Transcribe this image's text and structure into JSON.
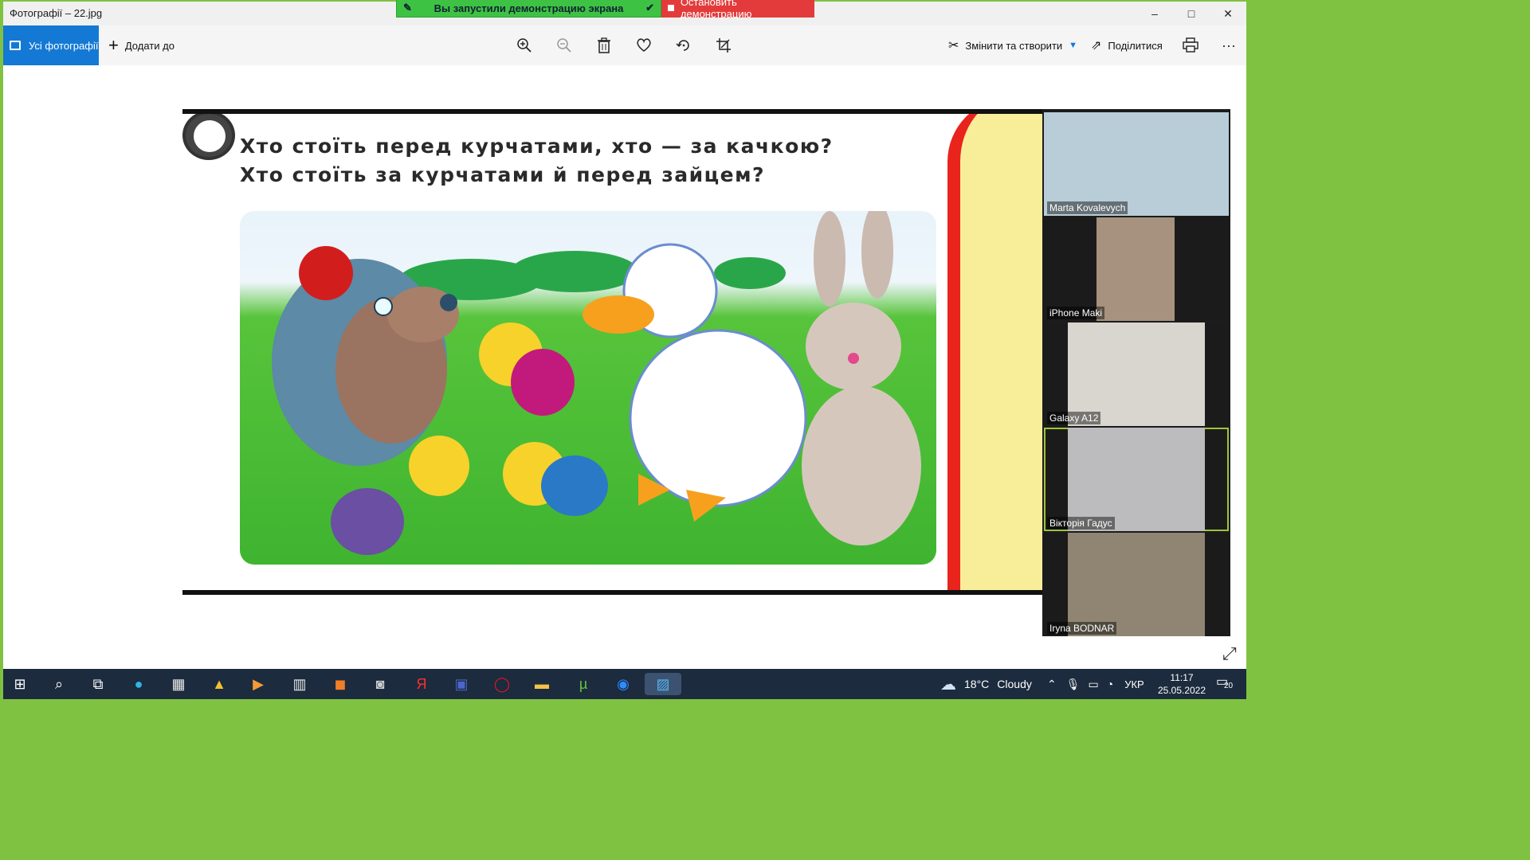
{
  "window": {
    "title": "Фотографії – 22.jpg",
    "controls": [
      "–",
      "□",
      "✕"
    ]
  },
  "share_banner": {
    "status": "Вы запустили демонстрацию экрана",
    "stop": "Остановить демонстрацию"
  },
  "toolbar": {
    "all_photos": "Усі фотографії",
    "add_to": "Додати до",
    "edit_create": "Змінити та створити",
    "share": "Поділитися",
    "more": "···",
    "icons": [
      "zoom-in-icon",
      "zoom-out-icon",
      "delete-icon",
      "heart-icon",
      "rotate-icon",
      "crop-icon",
      "print-icon"
    ]
  },
  "slide": {
    "question_line1": "Хто стоїть перед курчатами, хто — за качкою?",
    "question_line2": "Хто стоїть за курчатами й перед зайцем?"
  },
  "participants": [
    {
      "name": "Marta Kovalevych",
      "active": false,
      "tint": "#8aa7b8"
    },
    {
      "name": "iPhone Maki",
      "active": false,
      "tint": "#a6927e"
    },
    {
      "name": "Galaxy A12",
      "active": false,
      "tint": "#d9d5cf"
    },
    {
      "name": "Вікторія Гадус",
      "active": true,
      "tint": "#bcbcbe"
    },
    {
      "name": "Iryna BODNAR",
      "active": false,
      "tint": "#8f8572"
    }
  ],
  "taskbar": {
    "weather_temp": "18°C",
    "weather_text": "Cloudy",
    "lang": "УКР",
    "time": "11:17",
    "date": "25.05.2022",
    "notif_count": "20"
  },
  "colors": {
    "accent": "#1479d4",
    "share_green": "#3ec244",
    "share_red": "#e33b3b",
    "border_green": "#7fc241"
  }
}
